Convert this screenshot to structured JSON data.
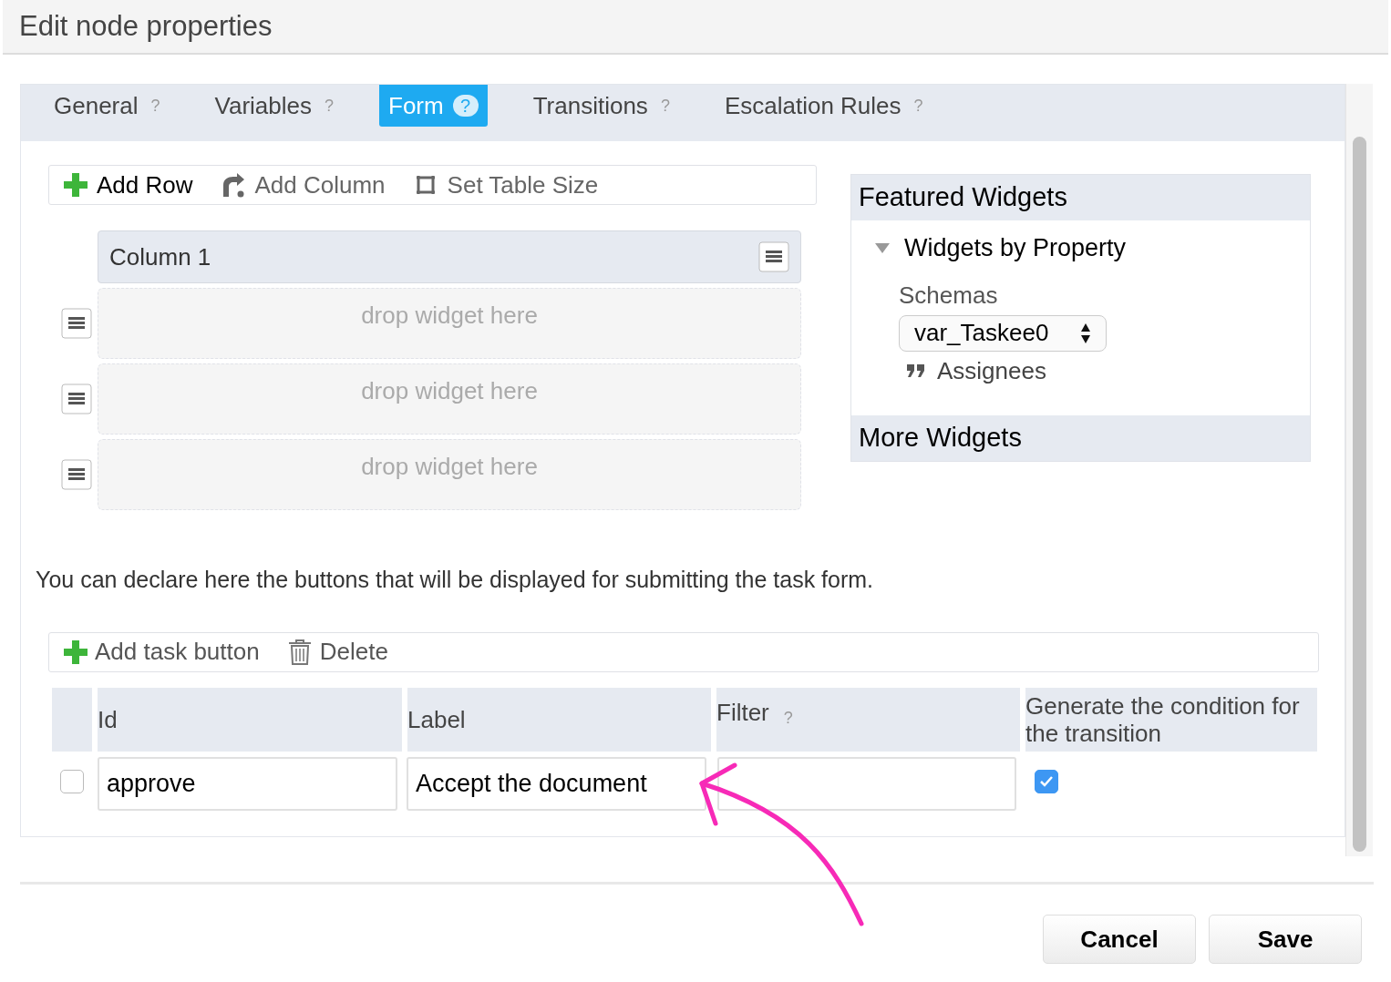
{
  "dialog": {
    "title": "Edit node properties"
  },
  "tabs": [
    {
      "label": "General",
      "help": "?",
      "selected": false
    },
    {
      "label": "Variables",
      "help": "?",
      "selected": false
    },
    {
      "label": "Form",
      "help": "?",
      "selected": true
    },
    {
      "label": "Transitions",
      "help": "?",
      "selected": false
    },
    {
      "label": "Escalation Rules",
      "help": "?",
      "selected": false
    }
  ],
  "form_toolbar": [
    {
      "kind": "add",
      "label": "Add Row",
      "disabled": false
    },
    {
      "kind": "column",
      "label": "Add Column",
      "disabled": true
    },
    {
      "kind": "size",
      "label": "Set Table Size",
      "disabled": true
    }
  ],
  "column": {
    "title": "Column 1"
  },
  "drop_zones": [
    "drop widget here",
    "drop widget here",
    "drop widget here"
  ],
  "featured": {
    "title": "Featured Widgets",
    "group": {
      "label": "Widgets by Property",
      "expanded": true,
      "schemas_label": "Schemas",
      "schema_select": "var_Taskee0",
      "items": [
        "Assignees"
      ]
    }
  },
  "more": {
    "title": "More Widgets"
  },
  "buttons_note": "You can declare here the buttons that will be displayed for submitting the task form.",
  "task_toolbar": [
    {
      "kind": "add",
      "label": "Add task button"
    },
    {
      "kind": "delete",
      "label": "Delete"
    }
  ],
  "table": {
    "columns": [
      {
        "label": "Id"
      },
      {
        "label": "Label"
      },
      {
        "label": "Filter",
        "help": "?"
      },
      {
        "label": "Generate the condition for the transition"
      }
    ],
    "rows": [
      {
        "checked": false,
        "id": "approve",
        "label": "Accept the document",
        "generate_condition": true
      }
    ]
  },
  "footer_buttons": [
    "Cancel",
    "Save"
  ]
}
